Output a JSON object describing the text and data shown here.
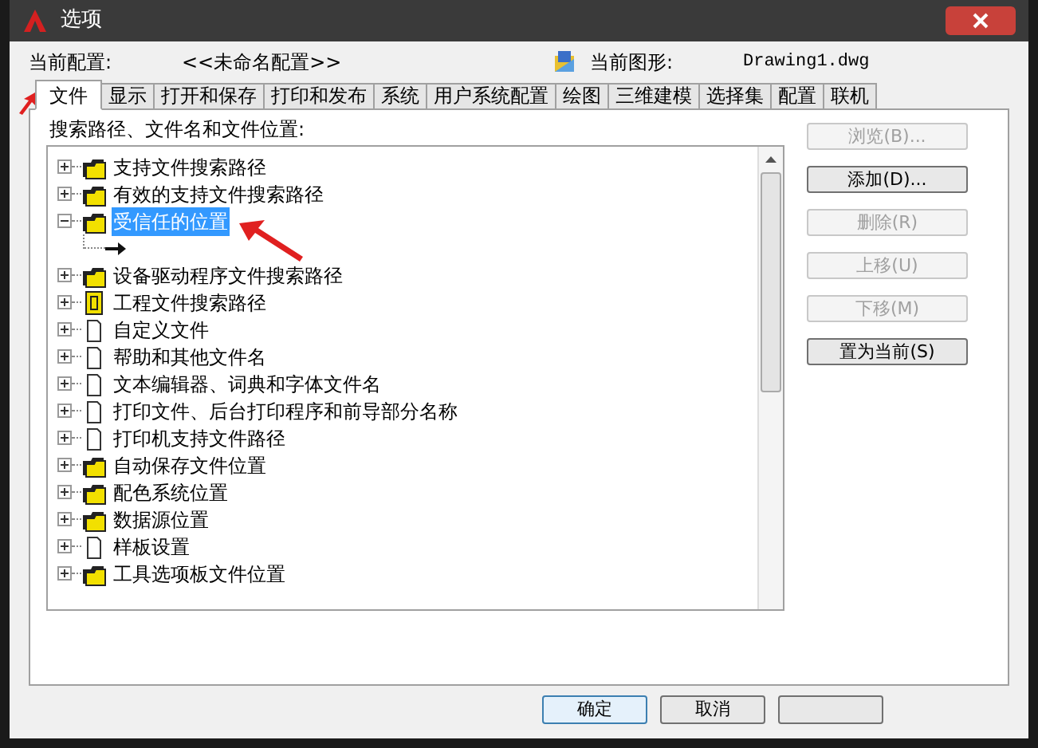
{
  "window": {
    "title": "选项"
  },
  "profile": {
    "label": "当前配置:",
    "value": "<<未命名配置>>"
  },
  "drawing": {
    "label": "当前图形:",
    "value": "Drawing1.dwg"
  },
  "tabs": [
    {
      "label": "文件",
      "selected": true
    },
    {
      "label": "显示",
      "selected": false
    },
    {
      "label": "打开和保存",
      "selected": false
    },
    {
      "label": "打印和发布",
      "selected": false
    },
    {
      "label": "系统",
      "selected": false
    },
    {
      "label": "用户系统配置",
      "selected": false
    },
    {
      "label": "绘图",
      "selected": false
    },
    {
      "label": "三维建模",
      "selected": false
    },
    {
      "label": "选择集",
      "selected": false
    },
    {
      "label": "配置",
      "selected": false
    },
    {
      "label": "联机",
      "selected": false
    }
  ],
  "tree_label": "搜索路径、文件名和文件位置:",
  "tree": [
    {
      "label": "支持文件搜索路径",
      "kind": "folder",
      "expanded": false,
      "selected": false
    },
    {
      "label": "有效的支持文件搜索路径",
      "kind": "folder",
      "expanded": false,
      "selected": false
    },
    {
      "label": "受信任的位置",
      "kind": "folder",
      "expanded": true,
      "selected": true,
      "children": [
        {
          "kind": "arrow"
        }
      ]
    },
    {
      "label": "设备驱动程序文件搜索路径",
      "kind": "folder",
      "expanded": false,
      "selected": false
    },
    {
      "label": "工程文件搜索路径",
      "kind": "project",
      "expanded": false,
      "selected": false
    },
    {
      "label": "自定义文件",
      "kind": "file",
      "expanded": false,
      "selected": false
    },
    {
      "label": "帮助和其他文件名",
      "kind": "file",
      "expanded": false,
      "selected": false
    },
    {
      "label": "文本编辑器、词典和字体文件名",
      "kind": "file",
      "expanded": false,
      "selected": false
    },
    {
      "label": "打印文件、后台打印程序和前导部分名称",
      "kind": "file",
      "expanded": false,
      "selected": false
    },
    {
      "label": "打印机支持文件路径",
      "kind": "file",
      "expanded": false,
      "selected": false
    },
    {
      "label": "自动保存文件位置",
      "kind": "folder",
      "expanded": false,
      "selected": false
    },
    {
      "label": "配色系统位置",
      "kind": "folder",
      "expanded": false,
      "selected": false
    },
    {
      "label": "数据源位置",
      "kind": "folder",
      "expanded": false,
      "selected": false
    },
    {
      "label": "样板设置",
      "kind": "file",
      "expanded": false,
      "selected": false
    },
    {
      "label": "工具选项板文件位置",
      "kind": "folder",
      "expanded": false,
      "selected": false
    }
  ],
  "side_buttons": [
    {
      "label": "浏览(B)...",
      "disabled": true
    },
    {
      "label": "添加(D)...",
      "disabled": false
    },
    {
      "label": "删除(R)",
      "disabled": true
    },
    {
      "label": "上移(U)",
      "disabled": true
    },
    {
      "label": "下移(M)",
      "disabled": true
    },
    {
      "label": "置为当前(S)",
      "disabled": false
    }
  ],
  "footer_buttons": [
    {
      "label": "确定",
      "default": true
    },
    {
      "label": "取消",
      "default": false
    },
    {
      "default": false
    }
  ]
}
